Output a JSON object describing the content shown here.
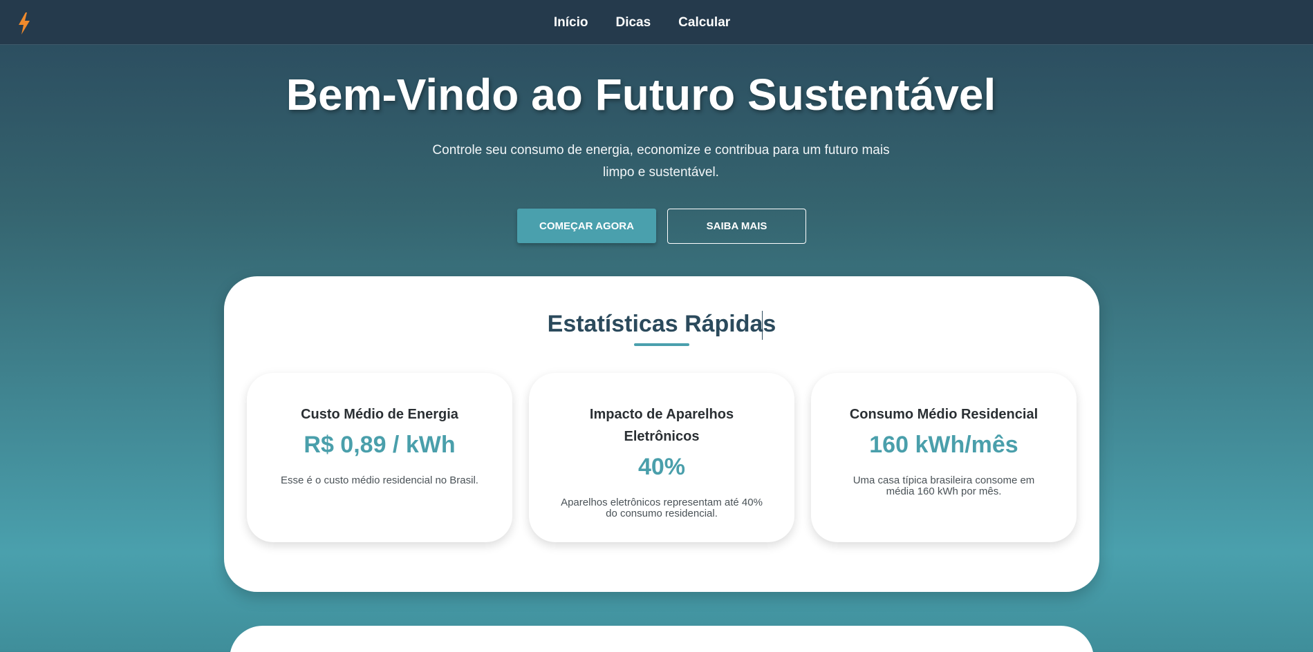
{
  "nav": {
    "logo_icon": "lightning-bolt-icon",
    "logo_color": "#f08a2c",
    "links": [
      "Início",
      "Dicas",
      "Calcular"
    ]
  },
  "hero": {
    "title": "Bem-Vindo ao Futuro Sustentável",
    "subtitle": "Controle seu consumo de energia, economize e contribua para um futuro mais limpo e sustentável.",
    "primary_button": "COMEÇAR AGORA",
    "secondary_button": "SAIBA MAIS"
  },
  "stats": {
    "title": "Estatísticas Rápidas",
    "cards": [
      {
        "title": "Custo Médio de Energia",
        "value": "R$ 0,89 / kWh",
        "description": "Esse é o custo médio residencial no Brasil."
      },
      {
        "title": "Impacto de Aparelhos Eletrônicos",
        "value": "40%",
        "description": "Aparelhos eletrônicos representam até 40% do consumo residencial."
      },
      {
        "title": "Consumo Médio Residencial",
        "value": "160 kWh/mês",
        "description": "Uma casa típica brasileira consome em média 160 kWh por mês."
      }
    ]
  },
  "colors": {
    "accent": "#4aa0ad",
    "header": "#253a4c",
    "title_dark": "#2b4a5c"
  }
}
